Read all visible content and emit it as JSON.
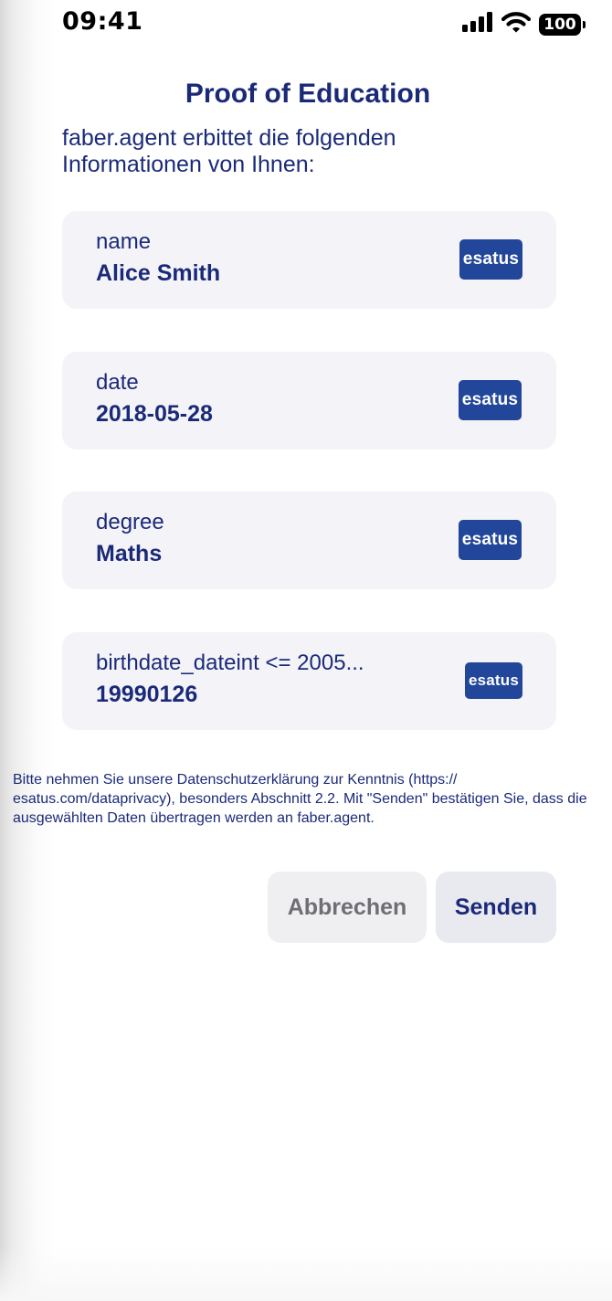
{
  "status_bar": {
    "time": "09:41",
    "battery": "100",
    "icons": [
      "cellular-signal-icon",
      "wifi-icon",
      "battery-icon"
    ]
  },
  "header": {
    "title": "Proof of Education",
    "intro": "faber.agent erbittet die folgenden Informationen von Ihnen:"
  },
  "attributes": [
    {
      "name": "name",
      "value": "Alice Smith",
      "issuer_logo": "esatus"
    },
    {
      "name": "date",
      "value": "2018-05-28",
      "issuer_logo": "esatus"
    },
    {
      "name": "degree",
      "value": "Maths",
      "issuer_logo": "esatus"
    },
    {
      "name": "birthdate_dateint <= 2005...",
      "value": "19990126",
      "issuer_logo": "esatus"
    }
  ],
  "privacy": {
    "before_link": "Bitte nehmen Sie unsere Datenschutzerklärung zur Kenntnis (",
    "link": "https://​esatus.com/dataprivacy",
    "after_link": "), besonders Abschnitt 2.2. Mit \"Senden\" bestätigen Sie, dass die ausgewählten Daten übertragen werden an faber.agent."
  },
  "buttons": {
    "cancel": "Abbrechen",
    "send": "Senden"
  },
  "colors": {
    "primary": "#1b2a78",
    "card_background": "#f4f4f8",
    "issuer_logo": "#21469a",
    "cancel_text": "#6e6e73"
  }
}
